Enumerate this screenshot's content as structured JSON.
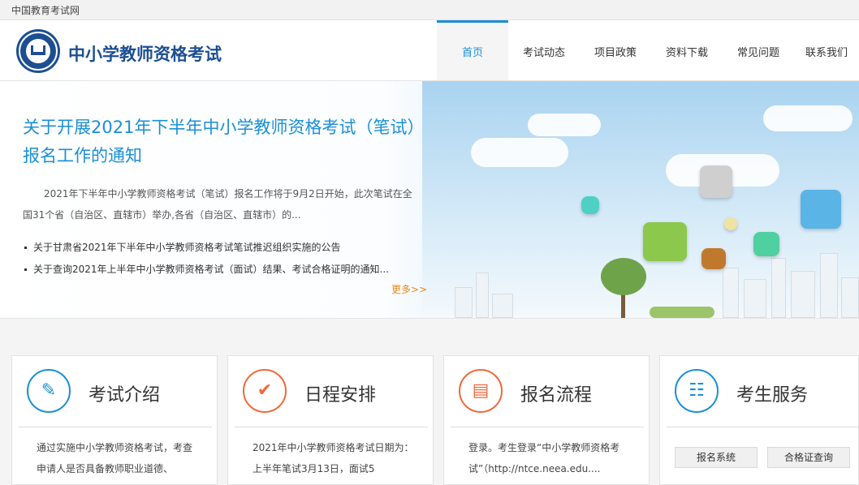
{
  "topbar": {
    "site_name": "中国教育考试网"
  },
  "header": {
    "title": "中小学教师资格考试"
  },
  "nav": [
    {
      "label": "首页",
      "active": true
    },
    {
      "label": "考试动态"
    },
    {
      "label": "项目政策"
    },
    {
      "label": "资料下载"
    },
    {
      "label": "常见问题"
    },
    {
      "label": "联系我们"
    }
  ],
  "banner": {
    "title": "关于开展2021年下半年中小学教师资格考试（笔试）报名工作的通知",
    "description": "2021年下半年中小学教师资格考试（笔试）报名工作将于9月2日开始，此次笔试在全国31个省（自治区、直辖市）举办,各省（自治区、直辖市）的...",
    "news": [
      "关于甘肃省2021年下半年中小学教师资格考试笔试推迟组织实施的公告",
      "关于查询2021年上半年中小学教师资格考试（面试）结果、考试合格证明的通知..."
    ],
    "more": "更多>>"
  },
  "cards": [
    {
      "title": "考试介绍",
      "icon": "document-edit-icon",
      "text": "通过实施中小学教师资格考试，考查申请人是否具备教师职业道德、"
    },
    {
      "title": "日程安排",
      "icon": "checkmark-icon",
      "text": "2021年中小学教师资格考试日期为：上半年笔试3月13日，面试5"
    },
    {
      "title": "报名流程",
      "icon": "form-edit-icon",
      "text": "登录。考生登录“中小学教师资格考试”（http://ntce.neea.edu...."
    },
    {
      "title": "考生服务",
      "icon": "address-book-icon",
      "buttons": [
        "报名系统",
        "合格证查询"
      ]
    }
  ],
  "colors": {
    "brand": "#1c4f92",
    "accent": "#1a8fd6",
    "more": "#e78a14",
    "orange_icon": "#ef6a3b"
  }
}
